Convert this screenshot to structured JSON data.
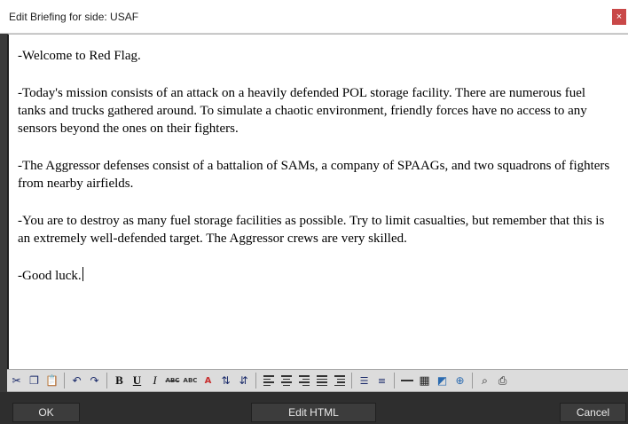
{
  "window": {
    "title": "Edit Briefing for side: USAF",
    "close_glyph": "×"
  },
  "editor": {
    "paragraphs": [
      "-Welcome to Red Flag.",
      "-Today's mission consists of an attack on a heavily defended POL storage facility. There are numerous fuel tanks and trucks gathered around. To simulate a chaotic environment, friendly forces have no access to any sensors beyond the ones on their fighters.",
      "-The Aggressor defenses consist of a battalion of SAMs, a company of SPAAGs, and two squadrons of fighters from nearby airfields.",
      "-You are to destroy as many fuel storage facilities as possible. Try to limit casualties, but remember that this is an extremely well-defended target. The Aggressor crews are very skilled.",
      "-Good luck."
    ]
  },
  "toolbar": {
    "bold": "B",
    "underline": "U",
    "italic": "I",
    "strike": "ABC",
    "caps": "ABC",
    "icons": [
      "cut-icon",
      "copy-icon",
      "paste-icon",
      "undo-icon",
      "redo-icon",
      "bold-icon",
      "underline-icon",
      "italic-icon",
      "strikethrough-icon",
      "spellcheck-icon",
      "font-color-icon",
      "sort-ascending-icon",
      "sort-descending-icon",
      "align-left-icon",
      "align-center-icon",
      "align-right-icon",
      "justify-icon",
      "indent-icon",
      "bullet-list-icon",
      "numbered-list-icon",
      "horizontal-rule-icon",
      "table-icon",
      "insert-image-icon",
      "insert-link-icon",
      "find-icon",
      "print-icon"
    ]
  },
  "buttons": {
    "ok": "OK",
    "edit_html": "Edit HTML",
    "cancel": "Cancel"
  }
}
